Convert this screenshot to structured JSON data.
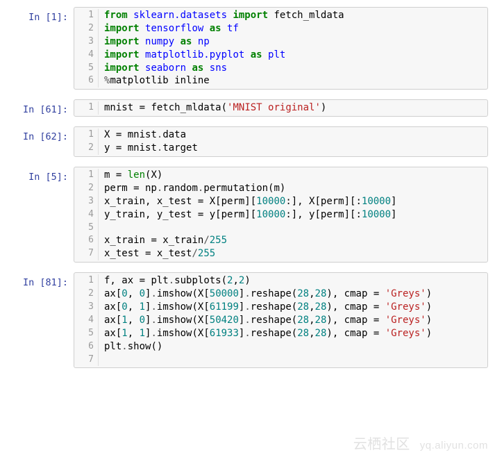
{
  "cells": [
    {
      "prompt": "In [1]:",
      "lines": [
        [
          {
            "t": "from",
            "cls": "tok-kw"
          },
          {
            "t": " "
          },
          {
            "t": "sklearn.datasets",
            "cls": "tok-nn"
          },
          {
            "t": " "
          },
          {
            "t": "import",
            "cls": "tok-kw"
          },
          {
            "t": " "
          },
          {
            "t": "fetch_mldata"
          }
        ],
        [
          {
            "t": "import",
            "cls": "tok-kw"
          },
          {
            "t": " "
          },
          {
            "t": "tensorflow",
            "cls": "tok-nn"
          },
          {
            "t": " "
          },
          {
            "t": "as",
            "cls": "tok-kw"
          },
          {
            "t": " "
          },
          {
            "t": "tf",
            "cls": "tok-nn"
          }
        ],
        [
          {
            "t": "import",
            "cls": "tok-kw"
          },
          {
            "t": " "
          },
          {
            "t": "numpy",
            "cls": "tok-nn"
          },
          {
            "t": " "
          },
          {
            "t": "as",
            "cls": "tok-kw"
          },
          {
            "t": " "
          },
          {
            "t": "np",
            "cls": "tok-nn"
          }
        ],
        [
          {
            "t": "import",
            "cls": "tok-kw"
          },
          {
            "t": " "
          },
          {
            "t": "matplotlib.pyplot",
            "cls": "tok-nn"
          },
          {
            "t": " "
          },
          {
            "t": "as",
            "cls": "tok-kw"
          },
          {
            "t": " "
          },
          {
            "t": "plt",
            "cls": "tok-nn"
          }
        ],
        [
          {
            "t": "import",
            "cls": "tok-kw"
          },
          {
            "t": " "
          },
          {
            "t": "seaborn",
            "cls": "tok-nn"
          },
          {
            "t": " "
          },
          {
            "t": "as",
            "cls": "tok-kw"
          },
          {
            "t": " "
          },
          {
            "t": "sns",
            "cls": "tok-nn"
          }
        ],
        [
          {
            "t": "%",
            "cls": "tok-op"
          },
          {
            "t": "matplotlib inline"
          }
        ]
      ]
    },
    {
      "prompt": "In [61]:",
      "lines": [
        [
          {
            "t": "mnist "
          },
          {
            "t": "="
          },
          {
            "t": " fetch_mldata("
          },
          {
            "t": "'MNIST original'",
            "cls": "tok-str"
          },
          {
            "t": ")"
          }
        ]
      ]
    },
    {
      "prompt": "In [62]:",
      "lines": [
        [
          {
            "t": "X "
          },
          {
            "t": "="
          },
          {
            "t": " mnist"
          },
          {
            "t": ".",
            "cls": "tok-op"
          },
          {
            "t": "data"
          }
        ],
        [
          {
            "t": "y "
          },
          {
            "t": "="
          },
          {
            "t": " mnist"
          },
          {
            "t": ".",
            "cls": "tok-op"
          },
          {
            "t": "target"
          }
        ]
      ]
    },
    {
      "prompt": "In [5]:",
      "lines": [
        [
          {
            "t": "m "
          },
          {
            "t": "="
          },
          {
            "t": " "
          },
          {
            "t": "len",
            "cls": "tok-builtin"
          },
          {
            "t": "(X)"
          }
        ],
        [
          {
            "t": "perm "
          },
          {
            "t": "="
          },
          {
            "t": " np"
          },
          {
            "t": ".",
            "cls": "tok-op"
          },
          {
            "t": "random"
          },
          {
            "t": ".",
            "cls": "tok-op"
          },
          {
            "t": "permutation(m)"
          }
        ],
        [
          {
            "t": "x_train, x_test "
          },
          {
            "t": "="
          },
          {
            "t": " X[perm]["
          },
          {
            "t": "10000",
            "cls": "tok-num"
          },
          {
            "t": ":], X[perm][:"
          },
          {
            "t": "10000",
            "cls": "tok-num"
          },
          {
            "t": "]"
          }
        ],
        [
          {
            "t": "y_train, y_test "
          },
          {
            "t": "="
          },
          {
            "t": " y[perm]["
          },
          {
            "t": "10000",
            "cls": "tok-num"
          },
          {
            "t": ":], y[perm][:"
          },
          {
            "t": "10000",
            "cls": "tok-num"
          },
          {
            "t": "]"
          }
        ],
        [],
        [
          {
            "t": "x_train "
          },
          {
            "t": "="
          },
          {
            "t": " x_train"
          },
          {
            "t": "/",
            "cls": "tok-op"
          },
          {
            "t": "255",
            "cls": "tok-num"
          }
        ],
        [
          {
            "t": "x_test "
          },
          {
            "t": "="
          },
          {
            "t": " x_test"
          },
          {
            "t": "/",
            "cls": "tok-op"
          },
          {
            "t": "255",
            "cls": "tok-num"
          }
        ]
      ]
    },
    {
      "prompt": "In [81]:",
      "lines": [
        [
          {
            "t": "f, ax "
          },
          {
            "t": "="
          },
          {
            "t": " plt"
          },
          {
            "t": ".",
            "cls": "tok-op"
          },
          {
            "t": "subplots("
          },
          {
            "t": "2",
            "cls": "tok-num"
          },
          {
            "t": ","
          },
          {
            "t": "2",
            "cls": "tok-num"
          },
          {
            "t": ")"
          }
        ],
        [
          {
            "t": "ax["
          },
          {
            "t": "0",
            "cls": "tok-num"
          },
          {
            "t": ", "
          },
          {
            "t": "0",
            "cls": "tok-num"
          },
          {
            "t": "]"
          },
          {
            "t": ".",
            "cls": "tok-op"
          },
          {
            "t": "imshow(X["
          },
          {
            "t": "50000",
            "cls": "tok-num"
          },
          {
            "t": "]"
          },
          {
            "t": ".",
            "cls": "tok-op"
          },
          {
            "t": "reshape("
          },
          {
            "t": "28",
            "cls": "tok-num"
          },
          {
            "t": ","
          },
          {
            "t": "28",
            "cls": "tok-num"
          },
          {
            "t": "), cmap "
          },
          {
            "t": "="
          },
          {
            "t": " "
          },
          {
            "t": "'Greys'",
            "cls": "tok-str"
          },
          {
            "t": ")"
          }
        ],
        [
          {
            "t": "ax["
          },
          {
            "t": "0",
            "cls": "tok-num"
          },
          {
            "t": ", "
          },
          {
            "t": "1",
            "cls": "tok-num"
          },
          {
            "t": "]"
          },
          {
            "t": ".",
            "cls": "tok-op"
          },
          {
            "t": "imshow(X["
          },
          {
            "t": "61199",
            "cls": "tok-num"
          },
          {
            "t": "]"
          },
          {
            "t": ".",
            "cls": "tok-op"
          },
          {
            "t": "reshape("
          },
          {
            "t": "28",
            "cls": "tok-num"
          },
          {
            "t": ","
          },
          {
            "t": "28",
            "cls": "tok-num"
          },
          {
            "t": "), cmap "
          },
          {
            "t": "="
          },
          {
            "t": " "
          },
          {
            "t": "'Greys'",
            "cls": "tok-str"
          },
          {
            "t": ")"
          }
        ],
        [
          {
            "t": "ax["
          },
          {
            "t": "1",
            "cls": "tok-num"
          },
          {
            "t": ", "
          },
          {
            "t": "0",
            "cls": "tok-num"
          },
          {
            "t": "]"
          },
          {
            "t": ".",
            "cls": "tok-op"
          },
          {
            "t": "imshow(X["
          },
          {
            "t": "50420",
            "cls": "tok-num"
          },
          {
            "t": "]"
          },
          {
            "t": ".",
            "cls": "tok-op"
          },
          {
            "t": "reshape("
          },
          {
            "t": "28",
            "cls": "tok-num"
          },
          {
            "t": ","
          },
          {
            "t": "28",
            "cls": "tok-num"
          },
          {
            "t": "), cmap "
          },
          {
            "t": "="
          },
          {
            "t": " "
          },
          {
            "t": "'Greys'",
            "cls": "tok-str"
          },
          {
            "t": ")"
          }
        ],
        [
          {
            "t": "ax["
          },
          {
            "t": "1",
            "cls": "tok-num"
          },
          {
            "t": ", "
          },
          {
            "t": "1",
            "cls": "tok-num"
          },
          {
            "t": "]"
          },
          {
            "t": ".",
            "cls": "tok-op"
          },
          {
            "t": "imshow(X["
          },
          {
            "t": "61933",
            "cls": "tok-num"
          },
          {
            "t": "]"
          },
          {
            "t": ".",
            "cls": "tok-op"
          },
          {
            "t": "reshape("
          },
          {
            "t": "28",
            "cls": "tok-num"
          },
          {
            "t": ","
          },
          {
            "t": "28",
            "cls": "tok-num"
          },
          {
            "t": "), cmap "
          },
          {
            "t": "="
          },
          {
            "t": " "
          },
          {
            "t": "'Greys'",
            "cls": "tok-str"
          },
          {
            "t": ")"
          }
        ],
        [
          {
            "t": "plt"
          },
          {
            "t": ".",
            "cls": "tok-op"
          },
          {
            "t": "show()"
          }
        ],
        []
      ]
    }
  ],
  "watermark": {
    "big": "云栖社区",
    "small": "yq.aliyun.com"
  }
}
